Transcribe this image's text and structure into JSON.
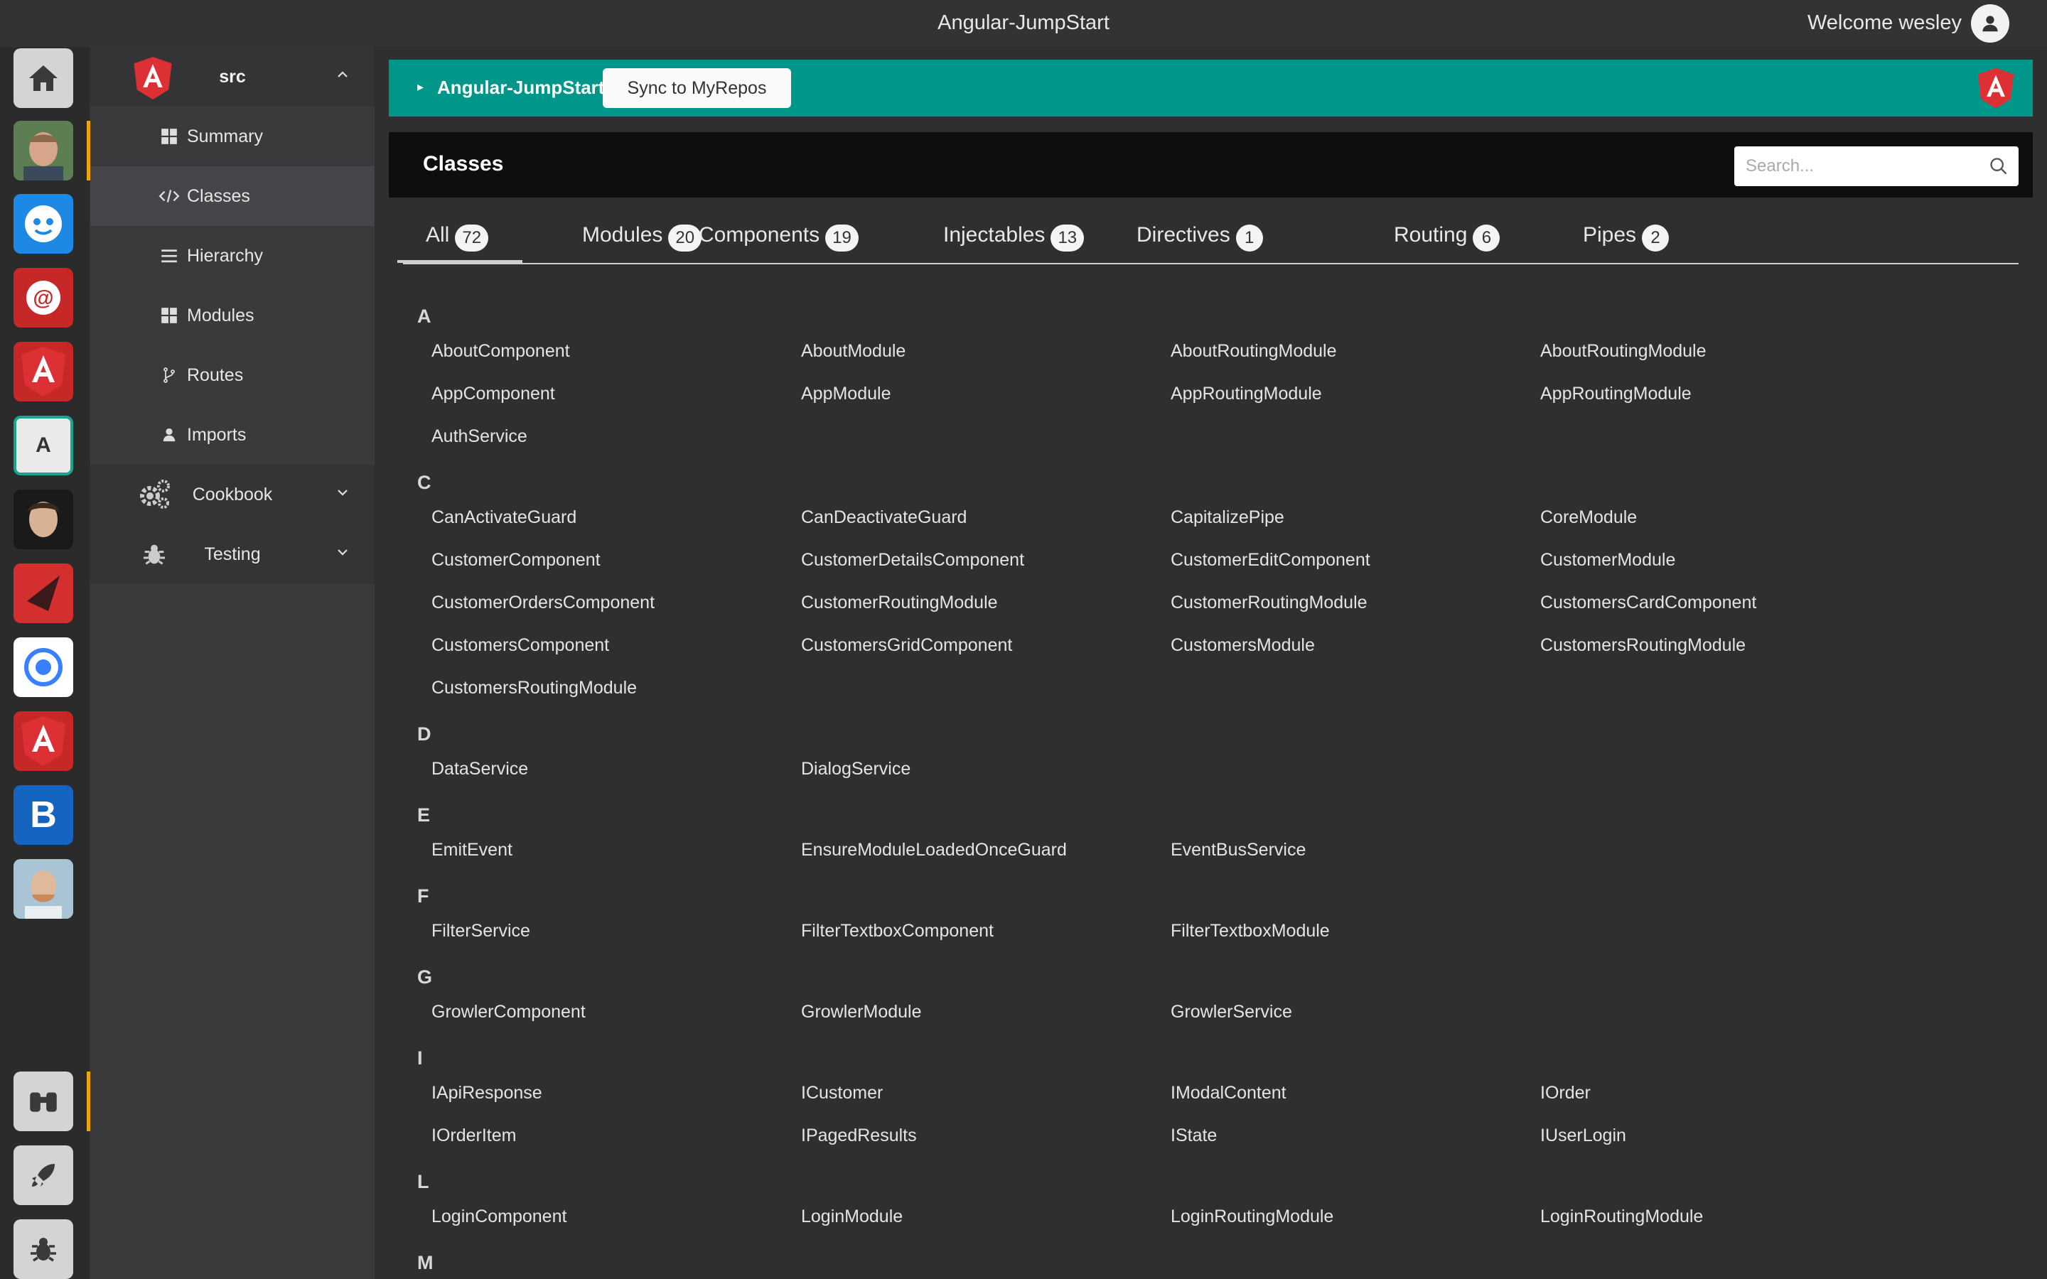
{
  "topbar": {
    "app_title": "Angular-JumpStart",
    "welcome": "Welcome wesley"
  },
  "rail": {
    "icons": [
      "home-icon",
      "avatar-photo-1",
      "robot-app-icon",
      "at-search-app-icon",
      "angular-app-icon",
      "a-letter-app-icon",
      "avatar-photo-2",
      "red-triangle-app-icon",
      "ionic-app-icon",
      "angular-app-icon-2",
      "bootstrap-app-icon",
      "avatar-photo-3"
    ],
    "bottom_icons": [
      "binoculars-icon",
      "rocket-icon",
      "bug-icon"
    ],
    "a_letter": "A",
    "b_letter": "B"
  },
  "sidebar": {
    "header": "src",
    "items": [
      {
        "label": "Summary",
        "icon": "grid-icon"
      },
      {
        "label": "Classes",
        "icon": "code-icon"
      },
      {
        "label": "Hierarchy",
        "icon": "list-icon"
      },
      {
        "label": "Modules",
        "icon": "grid-icon"
      },
      {
        "label": "Routes",
        "icon": "branch-icon"
      },
      {
        "label": "Imports",
        "icon": "person-icon"
      }
    ],
    "sections": [
      {
        "label": "Cookbook",
        "icon": "gears-icon"
      },
      {
        "label": "Testing",
        "icon": "bug-icon"
      }
    ]
  },
  "banner": {
    "project": "Angular-JumpStart",
    "sync_label": "Sync to MyRepos"
  },
  "classes_bar": {
    "title": "Classes",
    "search_placeholder": "Search..."
  },
  "tabs": [
    {
      "label": "All",
      "count": "72"
    },
    {
      "label": "Modules",
      "count": "20"
    },
    {
      "label": "Components",
      "count": "19"
    },
    {
      "label": "Injectables",
      "count": "13"
    },
    {
      "label": "Directives",
      "count": "1"
    },
    {
      "label": "Routing",
      "count": "6"
    },
    {
      "label": "Pipes",
      "count": "2"
    }
  ],
  "groups": [
    {
      "letter": "A",
      "rows": [
        [
          "AboutComponent",
          "AboutModule",
          "AboutRoutingModule",
          "AboutRoutingModule"
        ],
        [
          "AppComponent",
          "AppModule",
          "AppRoutingModule",
          "AppRoutingModule"
        ],
        [
          "AuthService"
        ]
      ]
    },
    {
      "letter": "C",
      "rows": [
        [
          "CanActivateGuard",
          "CanDeactivateGuard",
          "CapitalizePipe",
          "CoreModule"
        ],
        [
          "CustomerComponent",
          "CustomerDetailsComponent",
          "CustomerEditComponent",
          "CustomerModule"
        ],
        [
          "CustomerOrdersComponent",
          "CustomerRoutingModule",
          "CustomerRoutingModule",
          "CustomersCardComponent"
        ],
        [
          "CustomersComponent",
          "CustomersGridComponent",
          "CustomersModule",
          "CustomersRoutingModule"
        ],
        [
          "CustomersRoutingModule"
        ]
      ]
    },
    {
      "letter": "D",
      "rows": [
        [
          "DataService",
          "DialogService"
        ]
      ]
    },
    {
      "letter": "E",
      "rows": [
        [
          "EmitEvent",
          "EnsureModuleLoadedOnceGuard",
          "EventBusService"
        ]
      ]
    },
    {
      "letter": "F",
      "rows": [
        [
          "FilterService",
          "FilterTextboxComponent",
          "FilterTextboxModule"
        ]
      ]
    },
    {
      "letter": "G",
      "rows": [
        [
          "GrowlerComponent",
          "GrowlerModule",
          "GrowlerService"
        ]
      ]
    },
    {
      "letter": "I",
      "rows": [
        [
          "IApiResponse",
          "ICustomer",
          "IModalContent",
          "IOrder"
        ],
        [
          "IOrderItem",
          "IPagedResults",
          "IState",
          "IUserLogin"
        ]
      ]
    },
    {
      "letter": "L",
      "rows": [
        [
          "LoginComponent",
          "LoginModule",
          "LoginRoutingModule",
          "LoginRoutingModule"
        ]
      ]
    },
    {
      "letter": "M",
      "rows": []
    }
  ]
}
